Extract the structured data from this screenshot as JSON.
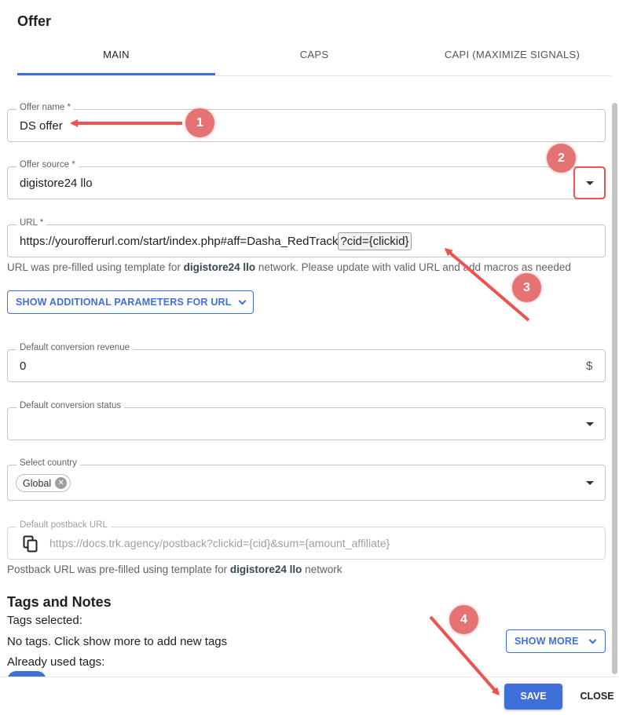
{
  "dialog": {
    "title": "Offer"
  },
  "tabs": [
    {
      "label": "MAIN",
      "active": true
    },
    {
      "label": "CAPS",
      "active": false
    },
    {
      "label": "CAPI (MAXIMIZE SIGNALS)",
      "active": false
    }
  ],
  "form": {
    "offer_name": {
      "label": "Offer name *",
      "value": "DS offer"
    },
    "offer_source": {
      "label": "Offer source *",
      "value": "digistore24 llo"
    },
    "url": {
      "label": "URL *",
      "value_main": "https://yourofferurl.com/start/index.php#aff=Dasha_RedTrack",
      "value_macro": "?cid={clickid}",
      "helper_prefix": "URL was pre-filled using template for ",
      "helper_bold": "digistore24 llo",
      "helper_suffix": " network. Please update with valid URL and add macros as needed"
    },
    "additional_params_button": "SHOW ADDITIONAL PARAMETERS FOR URL",
    "conversion_revenue": {
      "label": "Default conversion revenue",
      "value": "0",
      "currency": "$"
    },
    "conversion_status": {
      "label": "Default conversion status",
      "value": ""
    },
    "country": {
      "label": "Select country",
      "chip": "Global"
    },
    "postback": {
      "label": "Default postback URL",
      "placeholder": "https://docs.trk.agency/postback?clickid={cid}&sum={amount_affiliate}",
      "helper_prefix": "Postback URL was pre-filled using template for ",
      "helper_bold": "digistore24 llo",
      "helper_suffix": " network"
    }
  },
  "tags": {
    "heading": "Tags and Notes",
    "selected_label": "Tags selected:",
    "empty_text": "No tags. Click show more to add new tags",
    "show_more": "SHOW MORE",
    "used_label": "Already used tags:"
  },
  "footer": {
    "save": "SAVE",
    "close": "CLOSE"
  },
  "annotations": {
    "badges": [
      "1",
      "2",
      "3",
      "4"
    ],
    "color": "#e57373"
  },
  "colors": {
    "accent": "#3f6fd8",
    "annotation": "#ef5350"
  },
  "icons": [
    "dropdown-caret-icon",
    "copy-icon",
    "chip-remove-icon",
    "chevron-down-icon"
  ]
}
